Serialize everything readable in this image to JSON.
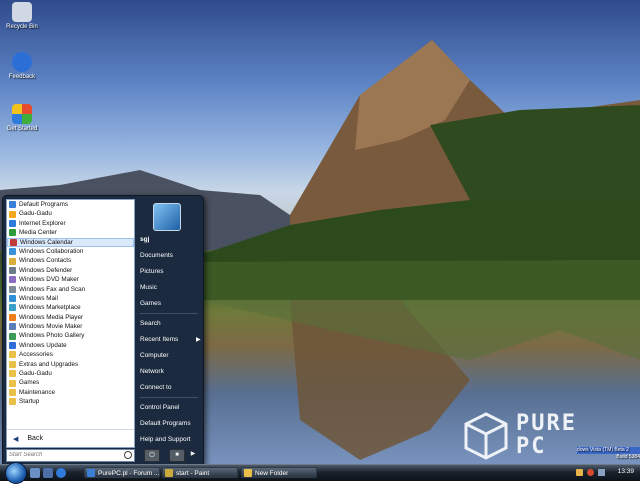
{
  "desktop": {
    "icons": [
      {
        "label": "Recycle Bin",
        "icon": "recycle-bin-icon",
        "color": "#cfd8e3"
      },
      {
        "label": "Feedback",
        "icon": "feedback-icon",
        "color": "#2b6fd6"
      },
      {
        "label": "Get Started",
        "icon": "get-started-icon",
        "color": "#e8a21f"
      }
    ],
    "watermark": {
      "line1": "PURE",
      "line2": "PC"
    },
    "version_line1": "dows Vista (TM) Beta 2",
    "version_line2": "Build 5384"
  },
  "start_menu": {
    "programs": [
      {
        "label": "Default Programs",
        "color": "#3a7fd6"
      },
      {
        "label": "Gadu-Gadu",
        "color": "#f2a81d"
      },
      {
        "label": "Internet Explorer",
        "color": "#2f7bdc"
      },
      {
        "label": "Media Center",
        "color": "#2e9c3d"
      },
      {
        "label": "Windows Calendar",
        "color": "#c23a3a"
      },
      {
        "label": "Windows Collaboration",
        "color": "#3a8fd6"
      },
      {
        "label": "Windows Contacts",
        "color": "#d6b03a"
      },
      {
        "label": "Windows Defender",
        "color": "#6c7a8a"
      },
      {
        "label": "Windows DVD Maker",
        "color": "#8a6cc2"
      },
      {
        "label": "Windows Fax and Scan",
        "color": "#7e8c99"
      },
      {
        "label": "Windows Mail",
        "color": "#2f8fd6"
      },
      {
        "label": "Windows Marketplace",
        "color": "#3aa0c8"
      },
      {
        "label": "Windows Media Player",
        "color": "#ef7f1a"
      },
      {
        "label": "Windows Movie Maker",
        "color": "#5d7fb8"
      },
      {
        "label": "Windows Photo Gallery",
        "color": "#3c9a5a"
      },
      {
        "label": "Windows Update",
        "color": "#2f6ed6"
      },
      {
        "label": "Accessories",
        "color": "#e9c04a"
      },
      {
        "label": "Extras and Upgrades",
        "color": "#e9c04a"
      },
      {
        "label": "Gadu-Gadu",
        "color": "#e9c04a"
      },
      {
        "label": "Games",
        "color": "#e9c04a"
      },
      {
        "label": "Maintenance",
        "color": "#e9c04a"
      },
      {
        "label": "Startup",
        "color": "#e9c04a"
      }
    ],
    "selected_program": "Windows Calendar",
    "back_label": "Back",
    "right_items": {
      "user": "sgj",
      "documents": "Documents",
      "pictures": "Pictures",
      "music": "Music",
      "games": "Games",
      "search": "Search",
      "recent_items": "Recent Items",
      "computer": "Computer",
      "network": "Network",
      "connect_to": "Connect to",
      "control_panel": "Control Panel",
      "default_programs": "Default Programs",
      "help_and_support": "Help and Support"
    },
    "search_placeholder": "Start Search"
  },
  "taskbar": {
    "buttons": [
      {
        "label": "PurePC.pl - Forum ...",
        "color": "#3b7fd6"
      },
      {
        "label": "start - Paint",
        "color": "#c9a93a"
      },
      {
        "label": "New Folder",
        "color": "#e9c04a"
      }
    ],
    "clock": "13:39"
  }
}
